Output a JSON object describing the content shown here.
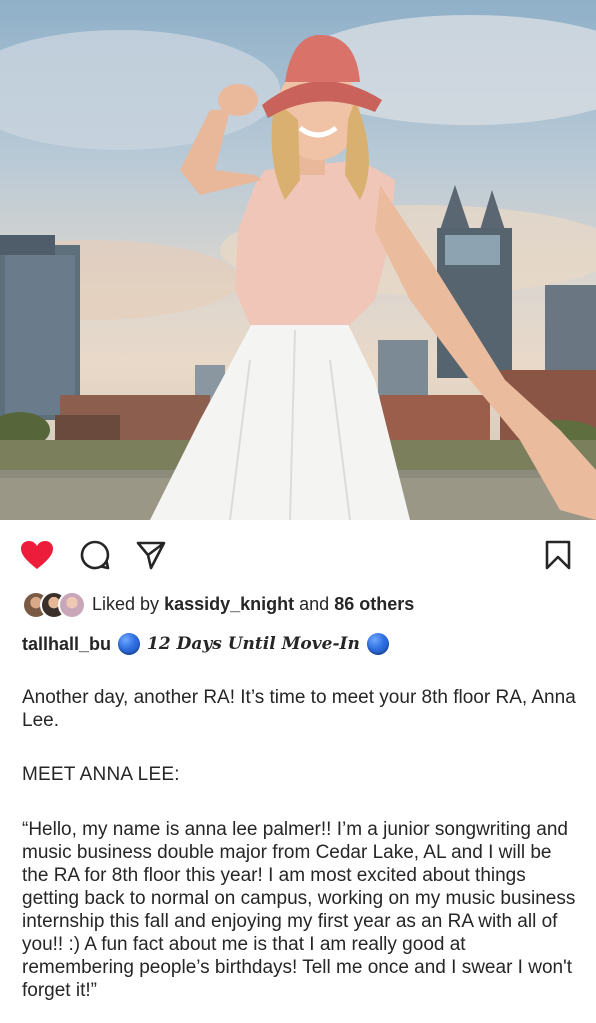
{
  "post": {
    "photo": {
      "alt_icon": "photo-woman-pink-bucket-hat-city-skyline"
    },
    "actions": {
      "like_icon": "heart-filled-icon",
      "comment_icon": "comment-bubble-icon",
      "share_icon": "paper-plane-icon",
      "save_icon": "bookmark-icon",
      "like_color": "#ed1c3a"
    },
    "likes": {
      "prefix": "Liked by",
      "user": "kassidy_knight",
      "connector": "and",
      "others": "86 others"
    },
    "caption": {
      "username": "tallhall_bu",
      "emoji_icon": "blue-circle-emoji",
      "countdown": "12 Days Until Move-In",
      "paragraph1": "Another day, another RA! It’s time to meet your 8th floor RA, Anna Lee.",
      "heading": "MEET ANNA LEE:",
      "paragraph2": "“Hello, my name is anna lee palmer!! I’m a junior songwriting and music business double major from Cedar Lake, AL and I will be the RA for 8th floor this year! I am most excited about things getting back to normal on campus, working on my music business internship this fall and enjoying my first year as an RA with all of you!! :) A fun fact about me is that I am really good at remembering people’s birthdays! Tell me once and I swear I won't forget it!”"
    }
  }
}
